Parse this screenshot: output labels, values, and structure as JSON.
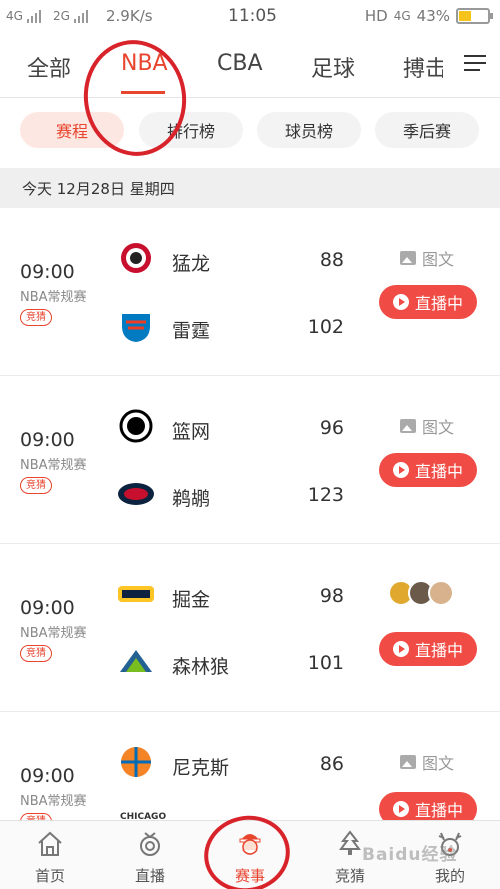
{
  "status_bar": {
    "network_1": "4G",
    "network_2": "2G",
    "speed": "2.9K/s",
    "time": "11:05",
    "hd_label": "HD",
    "network_right": "4G",
    "battery": "43%",
    "battery_level": 0.43
  },
  "tabs": [
    {
      "label": "全部",
      "active": false
    },
    {
      "label": "NBA",
      "active": true
    },
    {
      "label": "CBA",
      "active": false
    },
    {
      "label": "足球",
      "active": false
    },
    {
      "label": "搏击",
      "active": false
    }
  ],
  "subtabs": [
    {
      "label": "赛程",
      "active": true
    },
    {
      "label": "排行榜",
      "active": false
    },
    {
      "label": "球员榜",
      "active": false
    },
    {
      "label": "季后赛",
      "active": false
    }
  ],
  "date_header": "今天 12月28日 星期四",
  "games": [
    {
      "time": "09:00",
      "league": "NBA常规赛",
      "badge": "竞猜",
      "home": {
        "name": "猛龙",
        "score": "88",
        "logo": "raptors-logo"
      },
      "away": {
        "name": "雷霆",
        "score": "102",
        "logo": "thunder-logo"
      },
      "extra": "图文",
      "live_label": "直播中"
    },
    {
      "time": "09:00",
      "league": "NBA常规赛",
      "badge": "竞猜",
      "home": {
        "name": "篮网",
        "score": "96",
        "logo": "nets-logo"
      },
      "away": {
        "name": "鹈鹕",
        "score": "123",
        "logo": "pelicans-logo"
      },
      "extra": "图文",
      "live_label": "直播中"
    },
    {
      "time": "09:00",
      "league": "NBA常规赛",
      "badge": "竞猜",
      "home": {
        "name": "掘金",
        "score": "98",
        "logo": "nuggets-logo"
      },
      "away": {
        "name": "森林狼",
        "score": "101",
        "logo": "timberwolves-logo"
      },
      "extra": "",
      "live_label": "直播中"
    },
    {
      "time": "09:00",
      "league": "NBA常规赛",
      "badge": "竞猜",
      "home": {
        "name": "尼克斯",
        "score": "86",
        "logo": "knicks-logo"
      },
      "away": {
        "name": "",
        "score": "",
        "logo": "bulls-logo",
        "logo_text": "CHICAGO"
      },
      "extra": "图文",
      "live_label": "直播中"
    }
  ],
  "bottom_nav": [
    {
      "label": "首页",
      "icon": "home-icon",
      "active": false
    },
    {
      "label": "直播",
      "icon": "live-icon",
      "active": false
    },
    {
      "label": "赛事",
      "icon": "santa-icon",
      "active": true
    },
    {
      "label": "竞猜",
      "icon": "tree-icon",
      "active": false
    },
    {
      "label": "我的",
      "icon": "reindeer-icon",
      "active": false
    }
  ],
  "watermark": "Baidu经验",
  "colors": {
    "accent": "#e8452f",
    "live": "#f04b44",
    "annotation": "#d8232a"
  }
}
